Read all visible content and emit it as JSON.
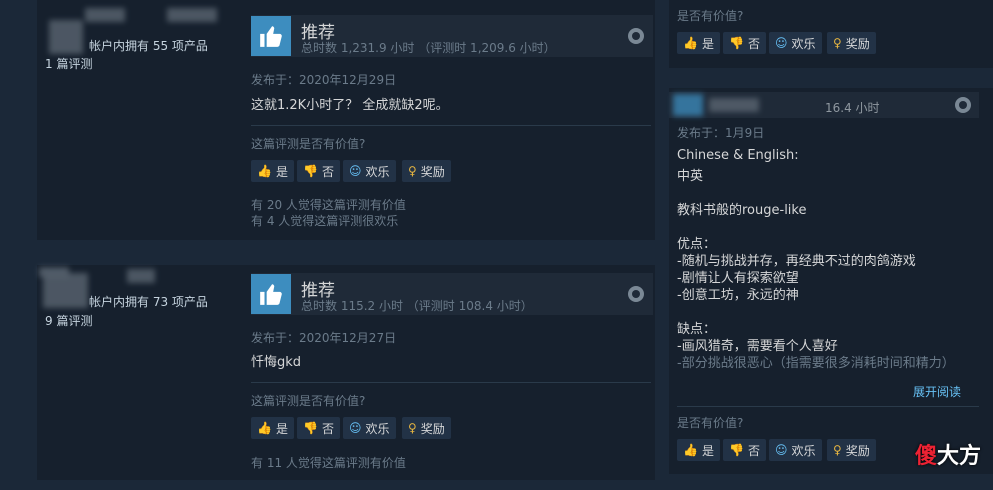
{
  "review_left_top": {
    "owned": "帐户内拥有 55 项产品",
    "review_count": "1 篇评测",
    "recommend": "推荐",
    "hours": "总时数 1,231.9 小时 （评测时 1,209.6 小时）",
    "posted": "发布于：2020年12月29日",
    "text": "这就1.2K小时了？ 全成就缺2呢。",
    "helpful_question": "这篇评测是否有价值?",
    "buttons": {
      "yes": "是",
      "no": "否",
      "funny": "欢乐",
      "award": "奖励"
    },
    "stats": [
      "有 20 人觉得这篇评测有价值",
      "有 4 人觉得这篇评测很欢乐"
    ]
  },
  "review_left_bottom": {
    "owned": "帐户内拥有 73 项产品",
    "review_count": "9 篇评测",
    "recommend": "推荐",
    "hours": "总时数 115.2 小时 （评测时 108.4 小时）",
    "posted": "发布于：2020年12月27日",
    "text": "忏悔gkd",
    "helpful_question": "这篇评测是否有价值?",
    "buttons": {
      "yes": "是",
      "no": "否",
      "funny": "欢乐",
      "award": "奖励"
    },
    "stats": [
      "有 11 人觉得这篇评测有价值"
    ]
  },
  "review_right_top": {
    "helpful_question": "是否有价值?",
    "buttons": {
      "yes": "是",
      "no": "否",
      "funny": "欢乐",
      "award": "奖励"
    }
  },
  "review_right_bottom": {
    "hours": "16.4 小时",
    "posted": "发布于：1月9日",
    "lines": [
      "Chinese & English:",
      "中英",
      "",
      "教科书般的rouge-like",
      "",
      "优点：",
      "-随机与挑战并存，再经典不过的肉鸽游戏",
      "-剧情让人有探索欲望",
      "-创意工坊，永远的神",
      "",
      "缺点：",
      "-画风猎奇，需要看个人喜好",
      "-部分挑战很恶心（指需要很多消耗时间和精力）"
    ],
    "expand": "展开阅读",
    "helpful_question": "是否有价值?",
    "buttons": {
      "yes": "是",
      "no": "否",
      "funny": "欢乐",
      "award": "奖励"
    }
  },
  "watermark": {
    "a": "傻",
    "b": "大方"
  },
  "icons": {
    "thumb": "thumbs-up-icon",
    "thumb_down": "thumbs-down-icon",
    "smile": "smile-icon",
    "award": "award-icon",
    "steam": "steam-icon"
  }
}
